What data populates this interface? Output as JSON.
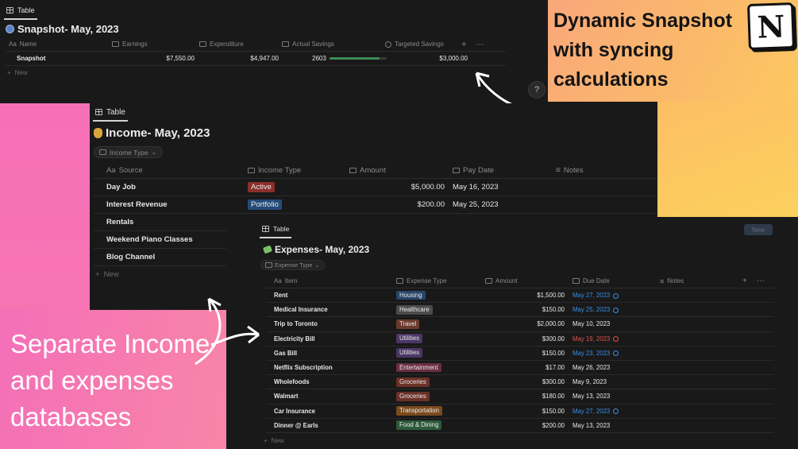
{
  "snapshot": {
    "tab": "Table",
    "title": "Snapshot- May, 2023",
    "columns": [
      "Name",
      "Earnings",
      "Expenditure",
      "Actual Savings",
      "Targeted Savings"
    ],
    "name_prefix": "Aa",
    "row": {
      "name": "Snapshot",
      "earnings": "$7,550.00",
      "expenditure": "$4,947.00",
      "actual": "2603",
      "progress": 0.87,
      "targeted": "$3,000.00"
    },
    "new_label": "New"
  },
  "income": {
    "tab": "Table",
    "title": "Income- May, 2023",
    "filter": "Income Type",
    "columns": [
      "Source",
      "Income Type",
      "Amount",
      "Pay Date",
      "Notes"
    ],
    "name_prefix": "Aa",
    "rows": [
      {
        "source": "Day Job",
        "type": "Active",
        "type_color": "#8b2e2a",
        "amount": "$5,000.00",
        "date": "May 16, 2023"
      },
      {
        "source": "Interest Revenue",
        "type": "Portfolio",
        "type_color": "#244c7a",
        "amount": "$200.00",
        "date": "May 25, 2023"
      },
      {
        "source": "Rentals",
        "type": "",
        "type_color": "",
        "amount": "",
        "date": ""
      },
      {
        "source": "Weekend Piano Classes",
        "type": "",
        "type_color": "",
        "amount": "",
        "date": ""
      },
      {
        "source": "Blog Channel",
        "type": "",
        "type_color": "",
        "amount": "",
        "date": ""
      }
    ],
    "new_label": "New"
  },
  "expenses": {
    "tab": "Table",
    "title": "Expenses- May, 2023",
    "filter": "Expense Type",
    "columns": [
      "Item",
      "Expense Type",
      "Amount",
      "Due Date",
      "Notes"
    ],
    "name_prefix": "Aa",
    "toolbar_new": "New",
    "rows": [
      {
        "item": "Rent",
        "type": "Housing",
        "color": "#28456b",
        "amount": "$1,500.00",
        "date": "May 27, 2023",
        "tone": "blue"
      },
      {
        "item": "Medical Insurance",
        "type": "Healthcare",
        "color": "#4b4b4b",
        "amount": "$150.00",
        "date": "May 25, 2023",
        "tone": "blue"
      },
      {
        "item": "Trip to Toronto",
        "type": "Travel",
        "color": "#6b3a2c",
        "amount": "$2,000.00",
        "date": "May 10, 2023",
        "tone": ""
      },
      {
        "item": "Electricity Bill",
        "type": "Utilities",
        "color": "#4a3665",
        "amount": "$300.00",
        "date": "May 19, 2023",
        "tone": "red"
      },
      {
        "item": "Gas Bill",
        "type": "Utilities",
        "color": "#4a3665",
        "amount": "$150.00",
        "date": "May 23, 2023",
        "tone": "blue"
      },
      {
        "item": "Netflix Subscription",
        "type": "Entertainment",
        "color": "#6a2e45",
        "amount": "$17.00",
        "date": "May 26, 2023",
        "tone": ""
      },
      {
        "item": "Wholefoods",
        "type": "Groceries",
        "color": "#6b3027",
        "amount": "$300.00",
        "date": "May 9, 2023",
        "tone": ""
      },
      {
        "item": "Walmart",
        "type": "Groceries",
        "color": "#6b3027",
        "amount": "$180.00",
        "date": "May 13, 2023",
        "tone": ""
      },
      {
        "item": "Car Insurance",
        "type": "Transportation",
        "color": "#7a4a1e",
        "amount": "$150.00",
        "date": "May 27, 2023",
        "tone": "blue"
      },
      {
        "item": "Dinner @ Earls",
        "type": "Food & Dining",
        "color": "#2c5a3a",
        "amount": "$200.00",
        "date": "May 13, 2023",
        "tone": ""
      }
    ],
    "new_label": "New"
  },
  "promo": {
    "right": "Dynamic Snapshot with syncing calculations",
    "left": "Separate Income and expenses databases",
    "logo": "N"
  },
  "help_label": "?",
  "colors": {
    "progress": "#3e8a5a",
    "blue_date": "#3b8ee6",
    "red_date": "#e0524a"
  }
}
